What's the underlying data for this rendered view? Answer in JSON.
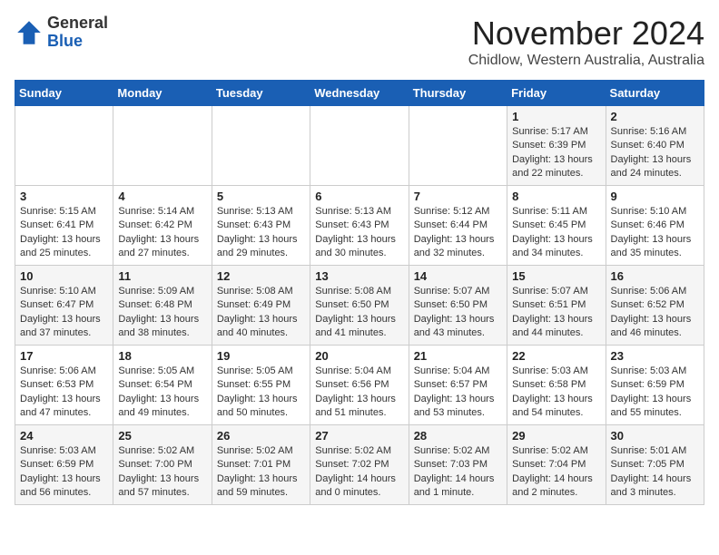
{
  "logo": {
    "general": "General",
    "blue": "Blue"
  },
  "header": {
    "month": "November 2024",
    "location": "Chidlow, Western Australia, Australia"
  },
  "weekdays": [
    "Sunday",
    "Monday",
    "Tuesday",
    "Wednesday",
    "Thursday",
    "Friday",
    "Saturday"
  ],
  "weeks": [
    [
      {
        "day": "",
        "text": ""
      },
      {
        "day": "",
        "text": ""
      },
      {
        "day": "",
        "text": ""
      },
      {
        "day": "",
        "text": ""
      },
      {
        "day": "",
        "text": ""
      },
      {
        "day": "1",
        "text": "Sunrise: 5:17 AM\nSunset: 6:39 PM\nDaylight: 13 hours\nand 22 minutes."
      },
      {
        "day": "2",
        "text": "Sunrise: 5:16 AM\nSunset: 6:40 PM\nDaylight: 13 hours\nand 24 minutes."
      }
    ],
    [
      {
        "day": "3",
        "text": "Sunrise: 5:15 AM\nSunset: 6:41 PM\nDaylight: 13 hours\nand 25 minutes."
      },
      {
        "day": "4",
        "text": "Sunrise: 5:14 AM\nSunset: 6:42 PM\nDaylight: 13 hours\nand 27 minutes."
      },
      {
        "day": "5",
        "text": "Sunrise: 5:13 AM\nSunset: 6:43 PM\nDaylight: 13 hours\nand 29 minutes."
      },
      {
        "day": "6",
        "text": "Sunrise: 5:13 AM\nSunset: 6:43 PM\nDaylight: 13 hours\nand 30 minutes."
      },
      {
        "day": "7",
        "text": "Sunrise: 5:12 AM\nSunset: 6:44 PM\nDaylight: 13 hours\nand 32 minutes."
      },
      {
        "day": "8",
        "text": "Sunrise: 5:11 AM\nSunset: 6:45 PM\nDaylight: 13 hours\nand 34 minutes."
      },
      {
        "day": "9",
        "text": "Sunrise: 5:10 AM\nSunset: 6:46 PM\nDaylight: 13 hours\nand 35 minutes."
      }
    ],
    [
      {
        "day": "10",
        "text": "Sunrise: 5:10 AM\nSunset: 6:47 PM\nDaylight: 13 hours\nand 37 minutes."
      },
      {
        "day": "11",
        "text": "Sunrise: 5:09 AM\nSunset: 6:48 PM\nDaylight: 13 hours\nand 38 minutes."
      },
      {
        "day": "12",
        "text": "Sunrise: 5:08 AM\nSunset: 6:49 PM\nDaylight: 13 hours\nand 40 minutes."
      },
      {
        "day": "13",
        "text": "Sunrise: 5:08 AM\nSunset: 6:50 PM\nDaylight: 13 hours\nand 41 minutes."
      },
      {
        "day": "14",
        "text": "Sunrise: 5:07 AM\nSunset: 6:50 PM\nDaylight: 13 hours\nand 43 minutes."
      },
      {
        "day": "15",
        "text": "Sunrise: 5:07 AM\nSunset: 6:51 PM\nDaylight: 13 hours\nand 44 minutes."
      },
      {
        "day": "16",
        "text": "Sunrise: 5:06 AM\nSunset: 6:52 PM\nDaylight: 13 hours\nand 46 minutes."
      }
    ],
    [
      {
        "day": "17",
        "text": "Sunrise: 5:06 AM\nSunset: 6:53 PM\nDaylight: 13 hours\nand 47 minutes."
      },
      {
        "day": "18",
        "text": "Sunrise: 5:05 AM\nSunset: 6:54 PM\nDaylight: 13 hours\nand 49 minutes."
      },
      {
        "day": "19",
        "text": "Sunrise: 5:05 AM\nSunset: 6:55 PM\nDaylight: 13 hours\nand 50 minutes."
      },
      {
        "day": "20",
        "text": "Sunrise: 5:04 AM\nSunset: 6:56 PM\nDaylight: 13 hours\nand 51 minutes."
      },
      {
        "day": "21",
        "text": "Sunrise: 5:04 AM\nSunset: 6:57 PM\nDaylight: 13 hours\nand 53 minutes."
      },
      {
        "day": "22",
        "text": "Sunrise: 5:03 AM\nSunset: 6:58 PM\nDaylight: 13 hours\nand 54 minutes."
      },
      {
        "day": "23",
        "text": "Sunrise: 5:03 AM\nSunset: 6:59 PM\nDaylight: 13 hours\nand 55 minutes."
      }
    ],
    [
      {
        "day": "24",
        "text": "Sunrise: 5:03 AM\nSunset: 6:59 PM\nDaylight: 13 hours\nand 56 minutes."
      },
      {
        "day": "25",
        "text": "Sunrise: 5:02 AM\nSunset: 7:00 PM\nDaylight: 13 hours\nand 57 minutes."
      },
      {
        "day": "26",
        "text": "Sunrise: 5:02 AM\nSunset: 7:01 PM\nDaylight: 13 hours\nand 59 minutes."
      },
      {
        "day": "27",
        "text": "Sunrise: 5:02 AM\nSunset: 7:02 PM\nDaylight: 14 hours\nand 0 minutes."
      },
      {
        "day": "28",
        "text": "Sunrise: 5:02 AM\nSunset: 7:03 PM\nDaylight: 14 hours\nand 1 minute."
      },
      {
        "day": "29",
        "text": "Sunrise: 5:02 AM\nSunset: 7:04 PM\nDaylight: 14 hours\nand 2 minutes."
      },
      {
        "day": "30",
        "text": "Sunrise: 5:01 AM\nSunset: 7:05 PM\nDaylight: 14 hours\nand 3 minutes."
      }
    ]
  ]
}
